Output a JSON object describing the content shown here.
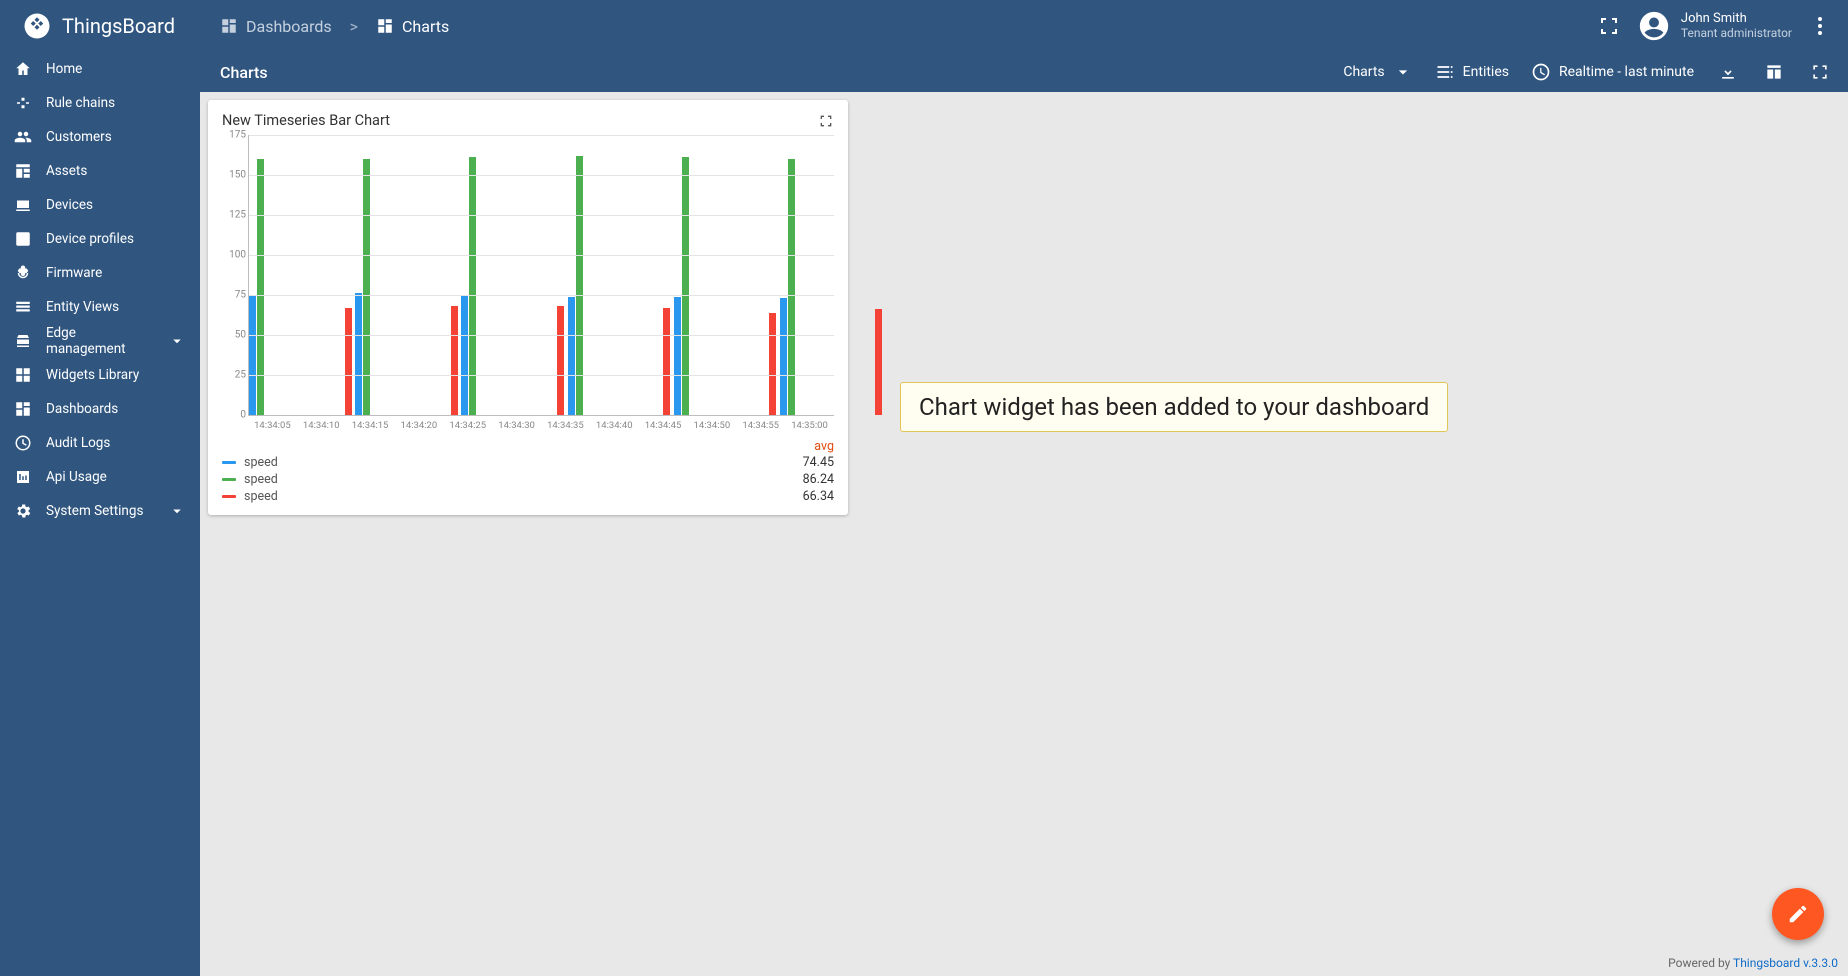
{
  "brand": {
    "name": "ThingsBoard"
  },
  "breadcrumb": {
    "items": [
      {
        "label": "Dashboards"
      },
      {
        "label": "Charts"
      }
    ],
    "sep": ">"
  },
  "user": {
    "name": "John Smith",
    "role": "Tenant administrator"
  },
  "sidebar": {
    "items": [
      {
        "label": "Home",
        "icon": "home"
      },
      {
        "label": "Rule chains",
        "icon": "rulechain"
      },
      {
        "label": "Customers",
        "icon": "customers"
      },
      {
        "label": "Assets",
        "icon": "assets"
      },
      {
        "label": "Devices",
        "icon": "devices"
      },
      {
        "label": "Device profiles",
        "icon": "deviceprofiles"
      },
      {
        "label": "Firmware",
        "icon": "firmware"
      },
      {
        "label": "Entity Views",
        "icon": "entityviews"
      },
      {
        "label": "Edge management",
        "icon": "edge",
        "expandable": true
      },
      {
        "label": "Widgets Library",
        "icon": "widgets"
      },
      {
        "label": "Dashboards",
        "icon": "dashboards"
      },
      {
        "label": "Audit Logs",
        "icon": "audit"
      },
      {
        "label": "Api Usage",
        "icon": "api"
      },
      {
        "label": "System Settings",
        "icon": "settings",
        "expandable": true
      }
    ]
  },
  "toolbar": {
    "title": "Charts",
    "state_select": "Charts",
    "entities": "Entities",
    "time": "Realtime - last minute"
  },
  "widget": {
    "title": "New Timeseries Bar Chart"
  },
  "callout": "Chart widget has been added to your dashboard",
  "footer": {
    "prefix": "Powered by ",
    "link": "Thingsboard v.3.3.0"
  },
  "legend_header": "avg",
  "chart_data": {
    "type": "bar",
    "title": "New Timeseries Bar Chart",
    "ylabel": "",
    "xlabel": "",
    "ylim": [
      0,
      175
    ],
    "y_ticks": [
      0,
      25,
      50,
      75,
      100,
      125,
      150,
      175
    ],
    "x_ticks": [
      "14:34:05",
      "14:34:10",
      "14:34:15",
      "14:34:20",
      "14:34:25",
      "14:34:30",
      "14:34:35",
      "14:34:40",
      "14:34:45",
      "14:34:50",
      "14:34:55",
      "14:35:00"
    ],
    "series": [
      {
        "name": "speed",
        "color": "#2b98f0",
        "avg": 74.45,
        "points": [
          {
            "x": "14:34:05",
            "y": 75
          },
          {
            "x": "14:34:15",
            "y": 76
          },
          {
            "x": "14:34:25",
            "y": 75
          },
          {
            "x": "14:34:35",
            "y": 74
          },
          {
            "x": "14:34:45",
            "y": 74
          },
          {
            "x": "14:34:55",
            "y": 73
          }
        ]
      },
      {
        "name": "speed",
        "color": "#4caf50",
        "avg": 86.24,
        "points": [
          {
            "x": "14:34:05",
            "y": 160
          },
          {
            "x": "14:34:15",
            "y": 160
          },
          {
            "x": "14:34:25",
            "y": 161
          },
          {
            "x": "14:34:35",
            "y": 162
          },
          {
            "x": "14:34:45",
            "y": 161
          },
          {
            "x": "14:34:55",
            "y": 160
          }
        ]
      },
      {
        "name": "speed",
        "color": "#f44336",
        "avg": 66.34,
        "points": [
          {
            "x": "14:34:14",
            "y": 67
          },
          {
            "x": "14:34:24",
            "y": 68
          },
          {
            "x": "14:34:34",
            "y": 68
          },
          {
            "x": "14:34:44",
            "y": 67
          },
          {
            "x": "14:34:54",
            "y": 64
          },
          {
            "x": "14:35:04",
            "y": 66
          }
        ]
      }
    ]
  }
}
